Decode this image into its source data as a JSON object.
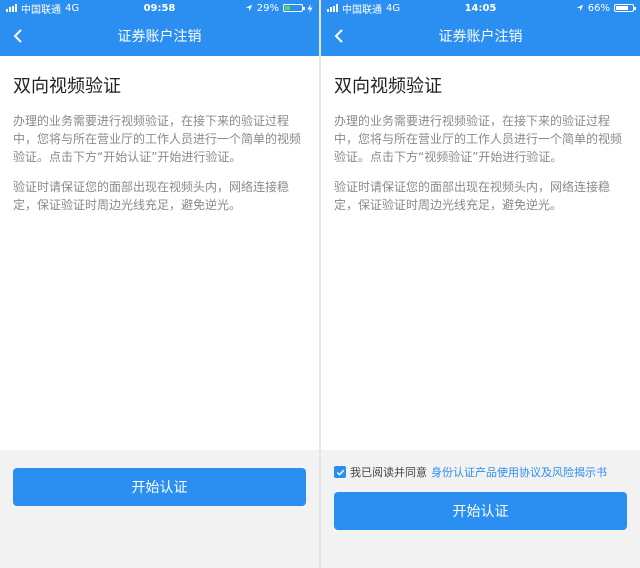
{
  "screens": [
    {
      "status": {
        "carrier": "中国联通",
        "network": "4G",
        "time": "09:58",
        "battery": "29%",
        "battery_level": 0.29
      },
      "nav": {
        "title": "证券账户注销"
      },
      "heading": "双向视频验证",
      "paragraphs": [
        "办理的业务需要进行视频验证，在接下来的验证过程中，您将与所在营业厅的工作人员进行一个简单的视频验证。点击下方“开始认证”开始进行验证。",
        "验证时请保证您的面部出现在视频头内，网络连接稳定，保证验证时周边光线充足，避免逆光。"
      ],
      "button_label": "开始认证"
    },
    {
      "status": {
        "carrier": "中国联通",
        "network": "4G",
        "time": "14:05",
        "battery": "66%",
        "battery_level": 0.66
      },
      "nav": {
        "title": "证券账户注销"
      },
      "heading": "双向视频验证",
      "paragraphs": [
        "办理的业务需要进行视频验证，在接下来的验证过程中，您将与所在营业厅的工作人员进行一个简单的视频验证。点击下方“视频验证”开始进行验证。",
        "验证时请保证您的面部出现在视频头内，网络连接稳定，保证验证时周边光线充足，避免逆光。"
      ],
      "agreement": {
        "prefix": "我已阅读并同意",
        "link": "身份认证产品使用协议及风险揭示书",
        "checked": true
      },
      "button_label": "开始认证"
    }
  ],
  "colors": {
    "primary": "#2b8ff2",
    "bottom_bg": "#f2f2f2",
    "text_muted": "#8a8a8a"
  },
  "icons": {
    "back": "chevron-left-icon",
    "location": "location-arrow-icon",
    "checkbox": "check-icon"
  }
}
